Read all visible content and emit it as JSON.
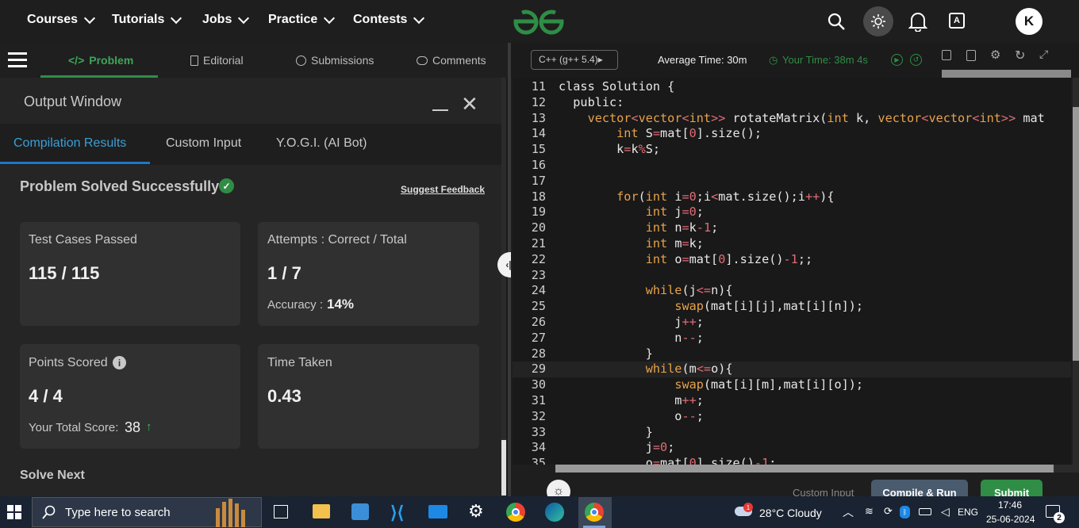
{
  "nav": {
    "items": [
      "Courses",
      "Tutorials",
      "Jobs",
      "Practice",
      "Contests"
    ],
    "avatar_letter": "K"
  },
  "problem_tabs": [
    "Problem",
    "Editorial",
    "Submissions",
    "Comments"
  ],
  "output": {
    "title": "Output Window",
    "tabs": [
      "Compilation Results",
      "Custom Input",
      "Y.O.G.I. (AI Bot)"
    ],
    "status": "Problem Solved Successfully",
    "feedback": "Suggest Feedback",
    "tests_label": "Test Cases Passed",
    "tests_value": "115 / 115",
    "attempts_label": "Attempts : Correct / Total",
    "attempts_value": "1 / 7",
    "accuracy_label": "Accuracy :",
    "accuracy_value": "14%",
    "points_label": "Points Scored",
    "points_value": "4 / 4",
    "total_label": "Your Total Score:",
    "total_value": "38",
    "time_label": "Time Taken",
    "time_value": "0.43",
    "solve_next": "Solve Next"
  },
  "editor": {
    "language": "C++ (g++ 5.4)",
    "avg_time": "Average Time: 30m",
    "your_time": "Your Time: 38m 4s",
    "custom_input": "Custom Input",
    "compile_run": "Compile & Run",
    "submit": "Submit",
    "lines": [
      {
        "n": "11",
        "t": "class Solution {"
      },
      {
        "n": "12",
        "t": "  public:"
      },
      {
        "n": "13",
        "t": "    vector<vector<int>> rotateMatrix(int k, vector<vector<int>> mat"
      },
      {
        "n": "14",
        "t": "        int S=mat[0].size();"
      },
      {
        "n": "15",
        "t": "        k=k%S;"
      },
      {
        "n": "16",
        "t": ""
      },
      {
        "n": "17",
        "t": ""
      },
      {
        "n": "18",
        "t": "        for(int i=0;i<mat.size();i++){"
      },
      {
        "n": "19",
        "t": "            int j=0;"
      },
      {
        "n": "20",
        "t": "            int n=k-1;"
      },
      {
        "n": "21",
        "t": "            int m=k;"
      },
      {
        "n": "22",
        "t": "            int o=mat[0].size()-1;;"
      },
      {
        "n": "23",
        "t": ""
      },
      {
        "n": "24",
        "t": "            while(j<=n){"
      },
      {
        "n": "25",
        "t": "                swap(mat[i][j],mat[i][n]);"
      },
      {
        "n": "26",
        "t": "                j++;"
      },
      {
        "n": "27",
        "t": "                n--;"
      },
      {
        "n": "28",
        "t": "            }"
      },
      {
        "n": "29",
        "t": "            while(m<=o){"
      },
      {
        "n": "30",
        "t": "                swap(mat[i][m],mat[i][o]);"
      },
      {
        "n": "31",
        "t": "                m++;"
      },
      {
        "n": "32",
        "t": "                o--;"
      },
      {
        "n": "33",
        "t": "            }"
      },
      {
        "n": "34",
        "t": "            j=0;"
      },
      {
        "n": "35",
        "t": "            o=mat[0].size()-1;"
      }
    ]
  },
  "taskbar": {
    "search": "Type here to search",
    "weather": "28°C  Cloudy",
    "lang": "ENG",
    "time": "17:46",
    "date": "25-06-2024",
    "notif": "2",
    "weather_badge": "1"
  }
}
